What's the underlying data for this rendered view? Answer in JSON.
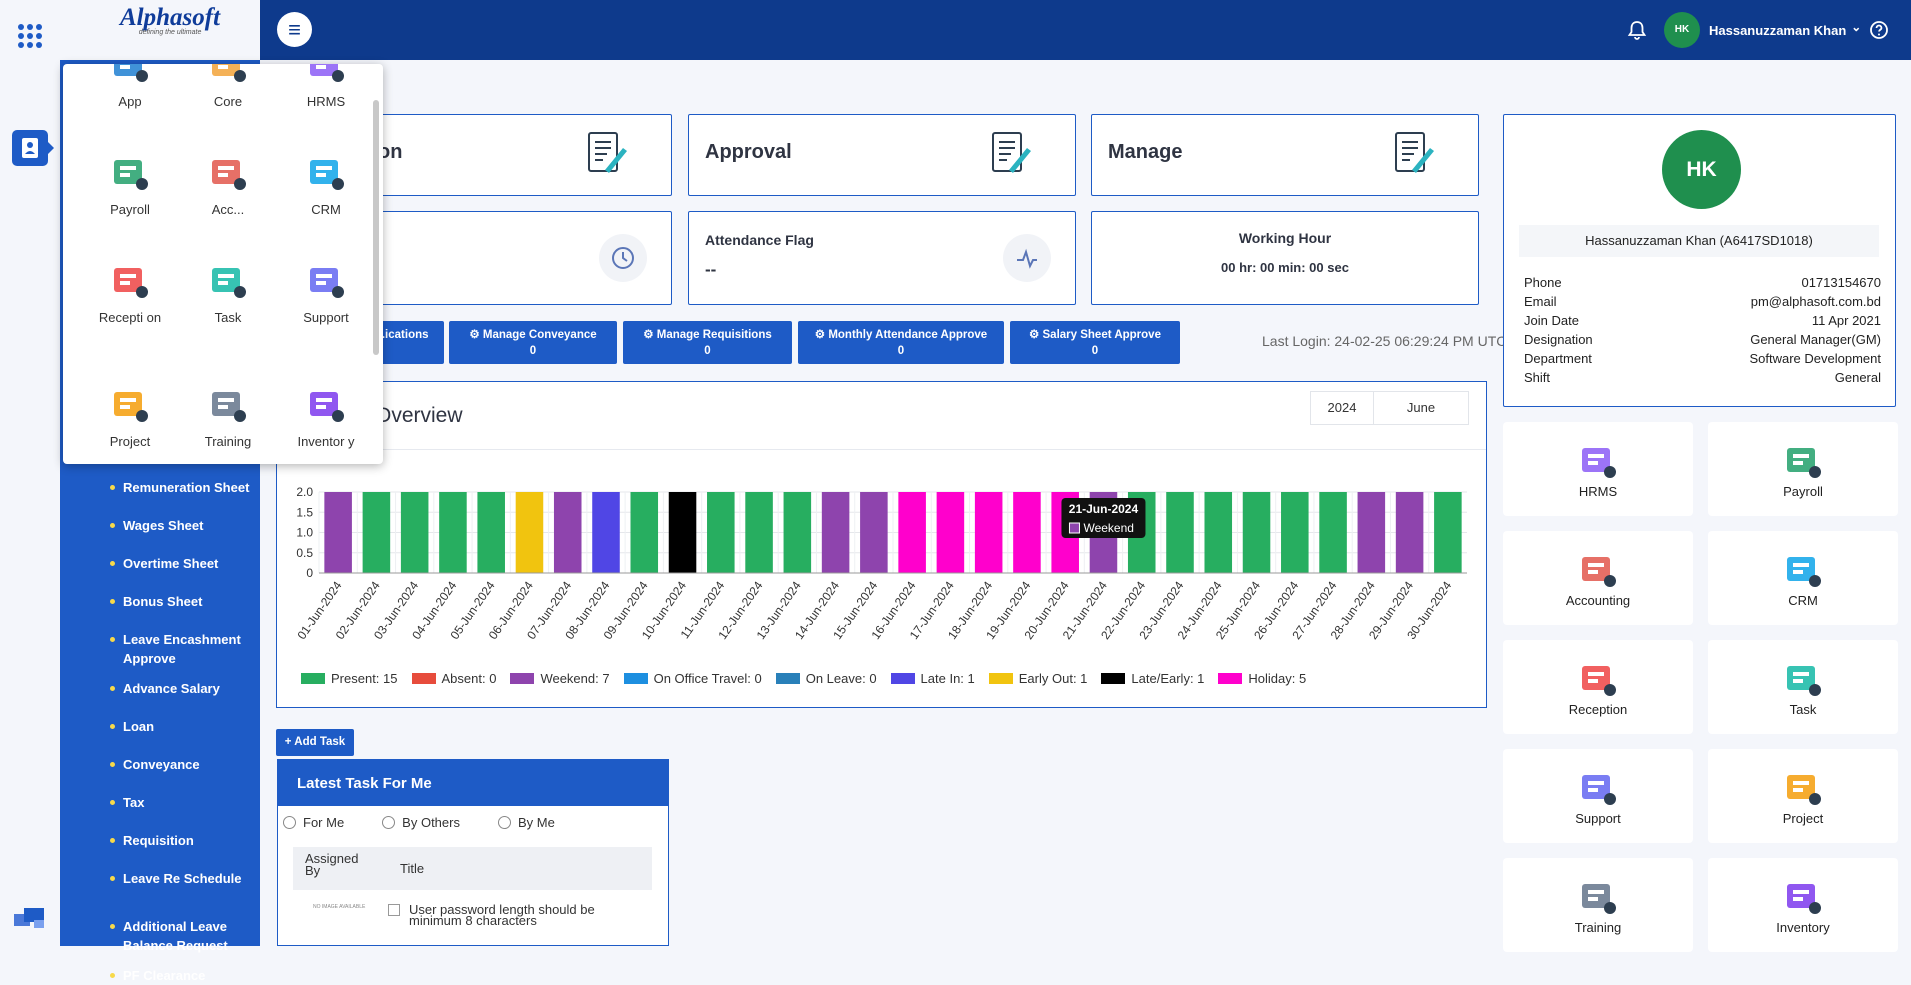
{
  "brand": {
    "logo": "Alphasoft",
    "tagline": "defining the ultimate"
  },
  "topbar": {
    "menu_icon": "hamburger-icon",
    "notification_icon": "bell-icon",
    "user_initials": "HK",
    "user_name": "Hassanuzzaman Khan",
    "caret": "⌄",
    "help_icon": "help-icon"
  },
  "app_popup": {
    "items": [
      "App",
      "Core",
      "HRMS",
      "Payroll",
      "Acc...",
      "CRM",
      "Recepti on",
      "Task",
      "Support",
      "Project",
      "Training",
      "Inventor y"
    ]
  },
  "sidebar": {
    "items": [
      "Remuneration Sheet",
      "Wages Sheet",
      "Overtime Sheet",
      "Bonus Sheet",
      "Leave Encashment Approve",
      "Advance Salary",
      "Loan",
      "Conveyance",
      "Tax",
      "Requisition",
      "Leave Re Schedule",
      "Additional Leave Balance Request",
      "PF Clearance"
    ]
  },
  "cards": {
    "application": "on",
    "approval": "Approval",
    "manage": "Manage",
    "attendance_flag_label": "Attendance Flag",
    "attendance_flag_value": "--",
    "working_hour_label": "Working Hour",
    "working_hour_value": "00 hr: 00 min: 00 sec"
  },
  "action_buttons": [
    {
      "label": "...ications",
      "count": ""
    },
    {
      "label": "Manage Conveyance",
      "count": "0"
    },
    {
      "label": "Manage Requisitions",
      "count": "0"
    },
    {
      "label": "Monthly Attendance Approve",
      "count": "0"
    },
    {
      "label": "Salary Sheet Approve",
      "count": "0"
    }
  ],
  "last_login": "Last Login: 24-02-25 06:29:24 PM UTC",
  "overview": {
    "title": "ce Overview",
    "year": "2024",
    "month": "June"
  },
  "chart_data": {
    "type": "bar",
    "ylim": [
      0,
      2
    ],
    "yticks": [
      "0",
      "0.5",
      "1.0",
      "1.5",
      "2.0"
    ],
    "categories": [
      "01-Jun-2024",
      "02-Jun-2024",
      "03-Jun-2024",
      "04-Jun-2024",
      "05-Jun-2024",
      "06-Jun-2024",
      "07-Jun-2024",
      "08-Jun-2024",
      "09-Jun-2024",
      "10-Jun-2024",
      "11-Jun-2024",
      "12-Jun-2024",
      "13-Jun-2024",
      "14-Jun-2024",
      "15-Jun-2024",
      "16-Jun-2024",
      "17-Jun-2024",
      "18-Jun-2024",
      "19-Jun-2024",
      "20-Jun-2024",
      "21-Jun-2024",
      "22-Jun-2024",
      "23-Jun-2024",
      "24-Jun-2024",
      "25-Jun-2024",
      "26-Jun-2024",
      "27-Jun-2024",
      "28-Jun-2024",
      "29-Jun-2024",
      "30-Jun-2024"
    ],
    "values": [
      2,
      2,
      2,
      2,
      2,
      2,
      2,
      2,
      2,
      2,
      2,
      2,
      2,
      2,
      2,
      2,
      2,
      2,
      2,
      2,
      2,
      2,
      2,
      2,
      2,
      2,
      2,
      2,
      2,
      2
    ],
    "status": [
      "Weekend",
      "Present",
      "Present",
      "Present",
      "Present",
      "Early Out",
      "Weekend",
      "Late In",
      "Present",
      "Late/Early",
      "Present",
      "Present",
      "Present",
      "Weekend",
      "Weekend",
      "Holiday",
      "Holiday",
      "Holiday",
      "Holiday",
      "Holiday",
      "Weekend",
      "Present",
      "Present",
      "Present",
      "Present",
      "Present",
      "Present",
      "Weekend",
      "Weekend",
      "Present"
    ],
    "legend": [
      {
        "name": "Present: 15",
        "key": "Present",
        "color": "#27ae60"
      },
      {
        "name": "Absent: 0",
        "key": "Absent",
        "color": "#e74c3c"
      },
      {
        "name": "Weekend: 7",
        "key": "Weekend",
        "color": "#8e44ad"
      },
      {
        "name": "On Office Travel: 0",
        "key": "On Office Travel",
        "color": "#1d8fe0"
      },
      {
        "name": "On Leave: 0",
        "key": "On Leave",
        "color": "#2980b9"
      },
      {
        "name": "Late In: 1",
        "key": "Late In",
        "color": "#5046e5"
      },
      {
        "name": "Early Out: 1",
        "key": "Early Out",
        "color": "#f1c40f"
      },
      {
        "name": "Late/Early: 1",
        "key": "Late/Early",
        "color": "#000000"
      },
      {
        "name": "Holiday: 5",
        "key": "Holiday",
        "color": "#ff00cc"
      }
    ],
    "tooltip": {
      "date": "21-Jun-2024",
      "status": "Weekend"
    }
  },
  "tasks": {
    "add_label": "+ Add Task",
    "title": "Latest Task For Me",
    "filters": [
      "For Me",
      "By Others",
      "By Me"
    ],
    "columns": [
      "Assigned By",
      "Title"
    ],
    "rows": [
      {
        "assigned": "NO IMAGE AVAILABLE",
        "title": "User password length should be minimum 8 characters"
      }
    ]
  },
  "profile": {
    "initials": "HK",
    "name": "Hassanuzzaman Khan (A6417SD1018)",
    "fields": [
      {
        "k": "Phone",
        "v": "01713154670"
      },
      {
        "k": "Email",
        "v": "pm@alphasoft.com.bd"
      },
      {
        "k": "Join Date",
        "v": "11 Apr 2021"
      },
      {
        "k": "Designation",
        "v": "General Manager(GM)"
      },
      {
        "k": "Department",
        "v": "Software Development"
      },
      {
        "k": "Shift",
        "v": "General"
      }
    ]
  },
  "modules": [
    "HRMS",
    "Payroll",
    "Accounting",
    "CRM",
    "Reception",
    "Task",
    "Support",
    "Project",
    "Training",
    "Inventory"
  ]
}
